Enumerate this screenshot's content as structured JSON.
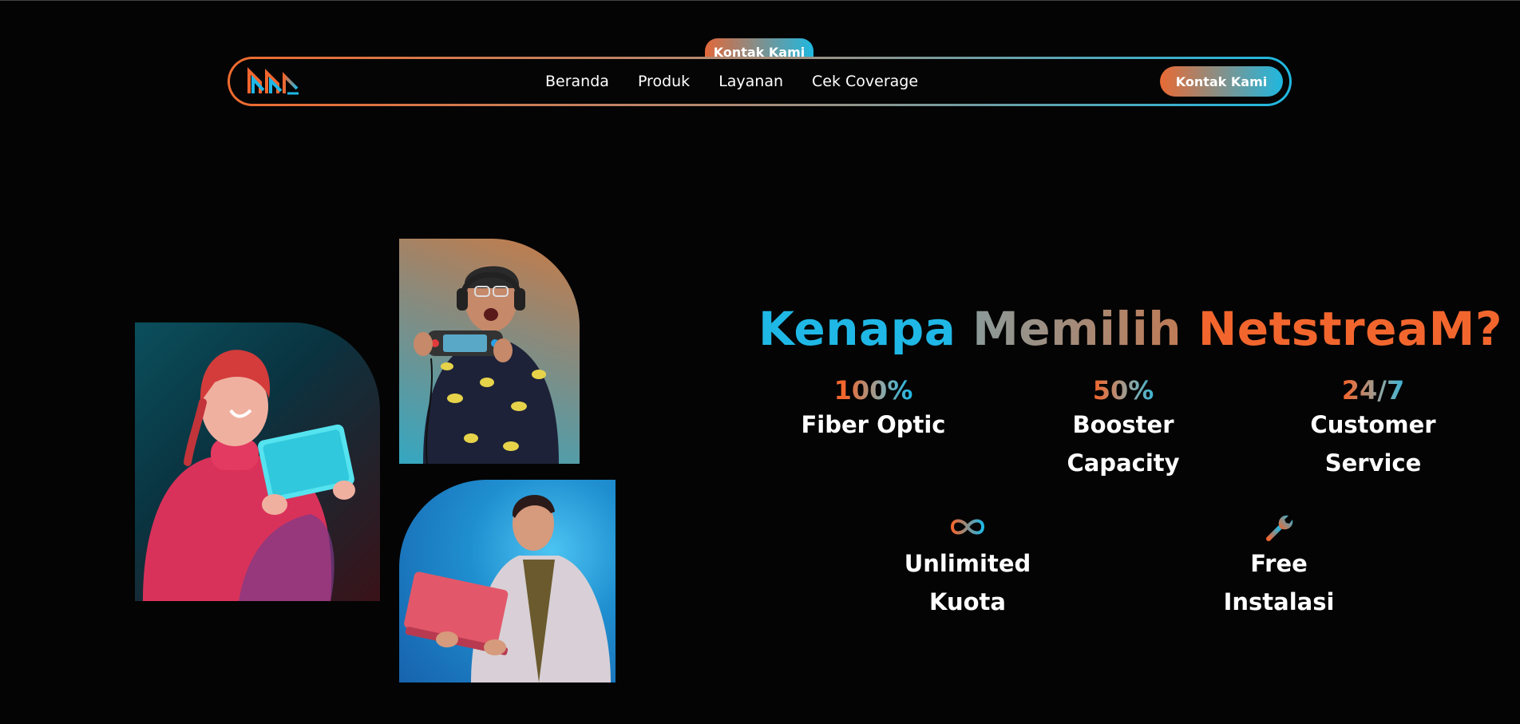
{
  "floating_tab": {
    "label": "Kontak Kami"
  },
  "navbar": {
    "logo_icon": "netstream-logo-icon",
    "links": [
      {
        "label": "Beranda"
      },
      {
        "label": "Produk"
      },
      {
        "label": "Layanan"
      },
      {
        "label": "Cek Coverage"
      }
    ],
    "cta_label": "Kontak Kami"
  },
  "hero": {
    "heading": {
      "word1": "Kenapa",
      "word2": "Memilih",
      "word3": "NetstreaM?"
    },
    "features": [
      {
        "stat": "100%",
        "label_line1": "Fiber Optic",
        "label_line2": ""
      },
      {
        "stat": "50%",
        "label_line1": "Booster",
        "label_line2": "Capacity"
      },
      {
        "stat": "24/7",
        "label_line1": "Customer",
        "label_line2": "Service"
      },
      {
        "icon": "infinity-icon",
        "label_line1": "Unlimited",
        "label_line2": "Kuota"
      },
      {
        "icon": "wrench-icon",
        "label_line1": "Free",
        "label_line2": "Instalasi"
      }
    ]
  },
  "colors": {
    "background": "#040404",
    "accent_orange": "#f2662e",
    "accent_blue": "#1fb8e6"
  }
}
